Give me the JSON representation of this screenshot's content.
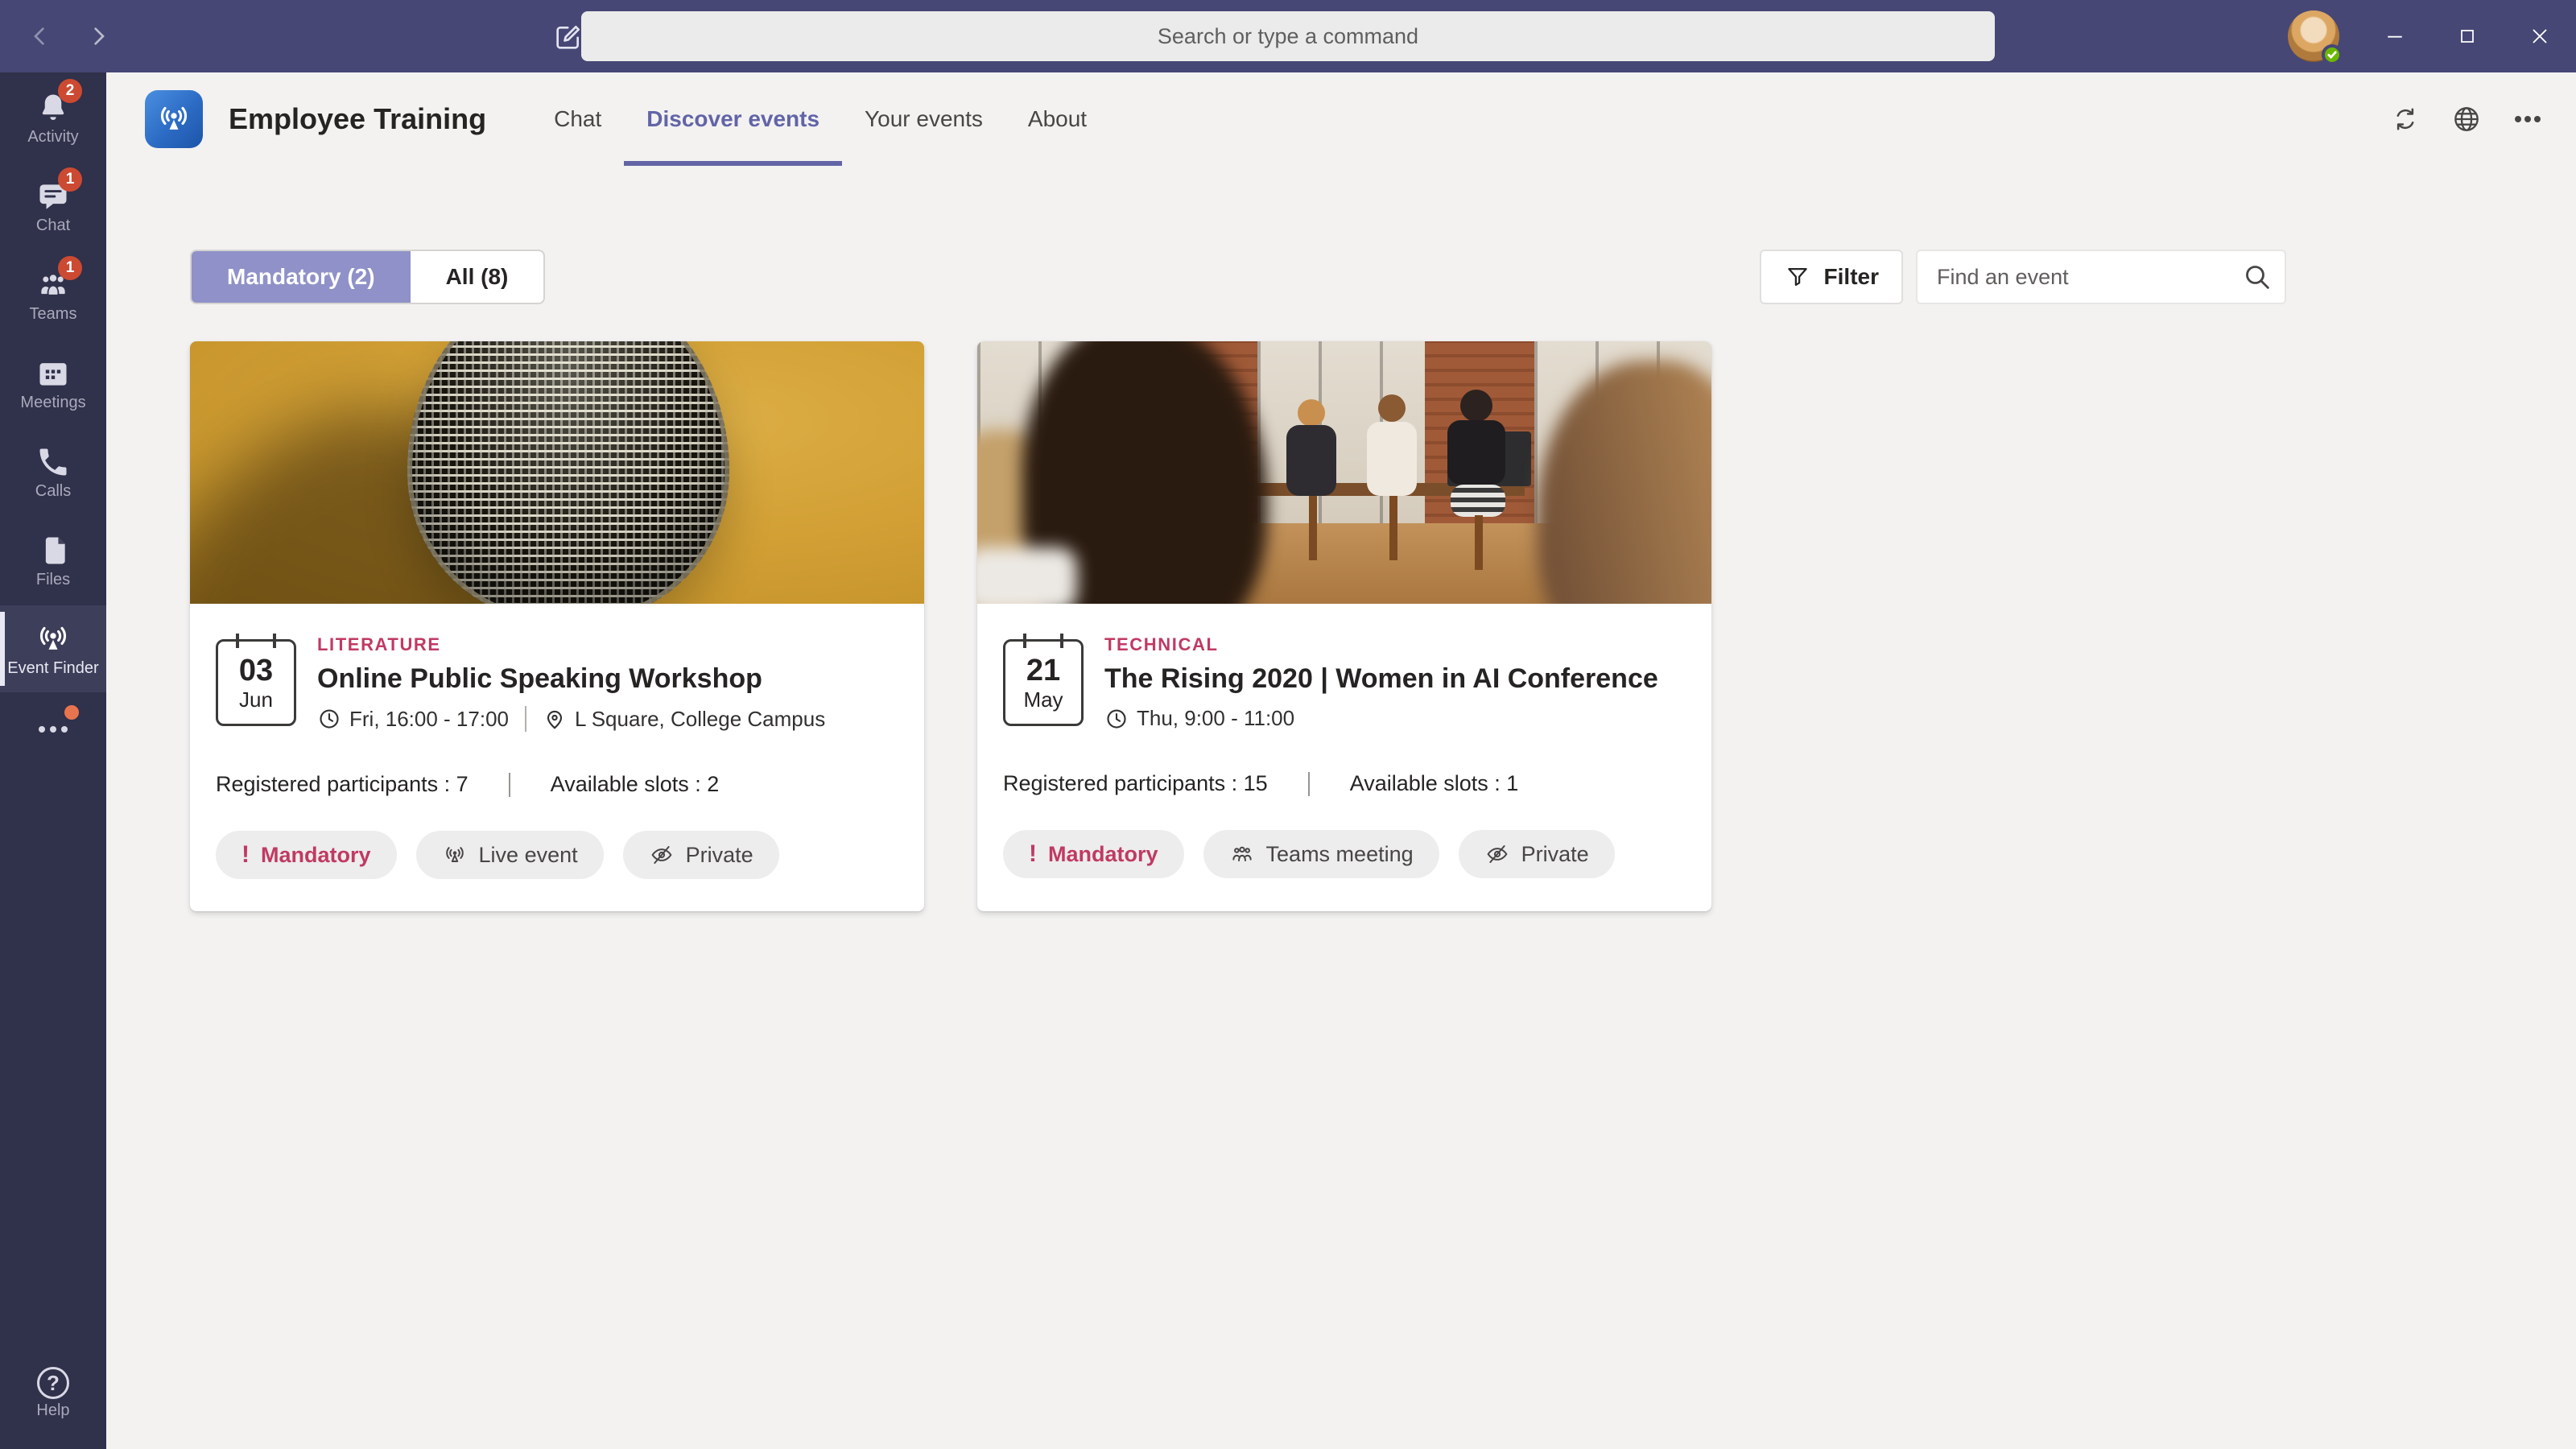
{
  "titlebar": {
    "search_placeholder": "Search or type a command"
  },
  "sidebar": {
    "items": [
      {
        "label": "Activity",
        "badge": "2"
      },
      {
        "label": "Chat",
        "badge": "1"
      },
      {
        "label": "Teams",
        "badge": "1"
      },
      {
        "label": "Meetings",
        "badge": ""
      },
      {
        "label": "Calls",
        "badge": ""
      },
      {
        "label": "Files",
        "badge": ""
      },
      {
        "label": "Event Finder",
        "badge": ""
      }
    ],
    "help_label": "Help",
    "help_icon_glyph": "?"
  },
  "header": {
    "app_name": "Employee Training",
    "tabs": [
      {
        "label": "Chat"
      },
      {
        "label": "Discover events"
      },
      {
        "label": "Your events"
      },
      {
        "label": "About"
      }
    ]
  },
  "toolbar": {
    "segments": [
      {
        "label": "Mandatory (2)"
      },
      {
        "label": "All (8)"
      }
    ],
    "filter_label": "Filter",
    "search_placeholder": "Find an event"
  },
  "cards": [
    {
      "day": "03",
      "month": "Jun",
      "category": "LITERATURE",
      "title": "Online Public Speaking Workshop",
      "time": "Fri, 16:00 - 17:00",
      "location": "L Square, College Campus",
      "registered": "Registered participants : 7",
      "slots": "Available slots : 2",
      "badges": [
        {
          "label": "Mandatory",
          "icon_glyph": "!"
        },
        {
          "label": "Live event"
        },
        {
          "label": "Private"
        }
      ]
    },
    {
      "day": "21",
      "month": "May",
      "category": "TECHNICAL",
      "title": "The Rising 2020 | Women in AI Conference",
      "time": "Thu, 9:00 - 11:00",
      "registered": "Registered participants : 15",
      "slots": "Available slots : 1",
      "badges": [
        {
          "label": "Mandatory",
          "icon_glyph": "!"
        },
        {
          "label": "Teams meeting"
        },
        {
          "label": "Private"
        }
      ]
    }
  ],
  "colors": {
    "titlebar": "#464775",
    "rail": "#30314a",
    "accent": "#6264a7",
    "selected_segment": "#8f91c8",
    "category_pink": "#c03a63",
    "notification_red": "#cc4a31",
    "presence_green": "#6bb700",
    "more_orange": "#e8744f",
    "content_bg": "#f3f2f1"
  }
}
